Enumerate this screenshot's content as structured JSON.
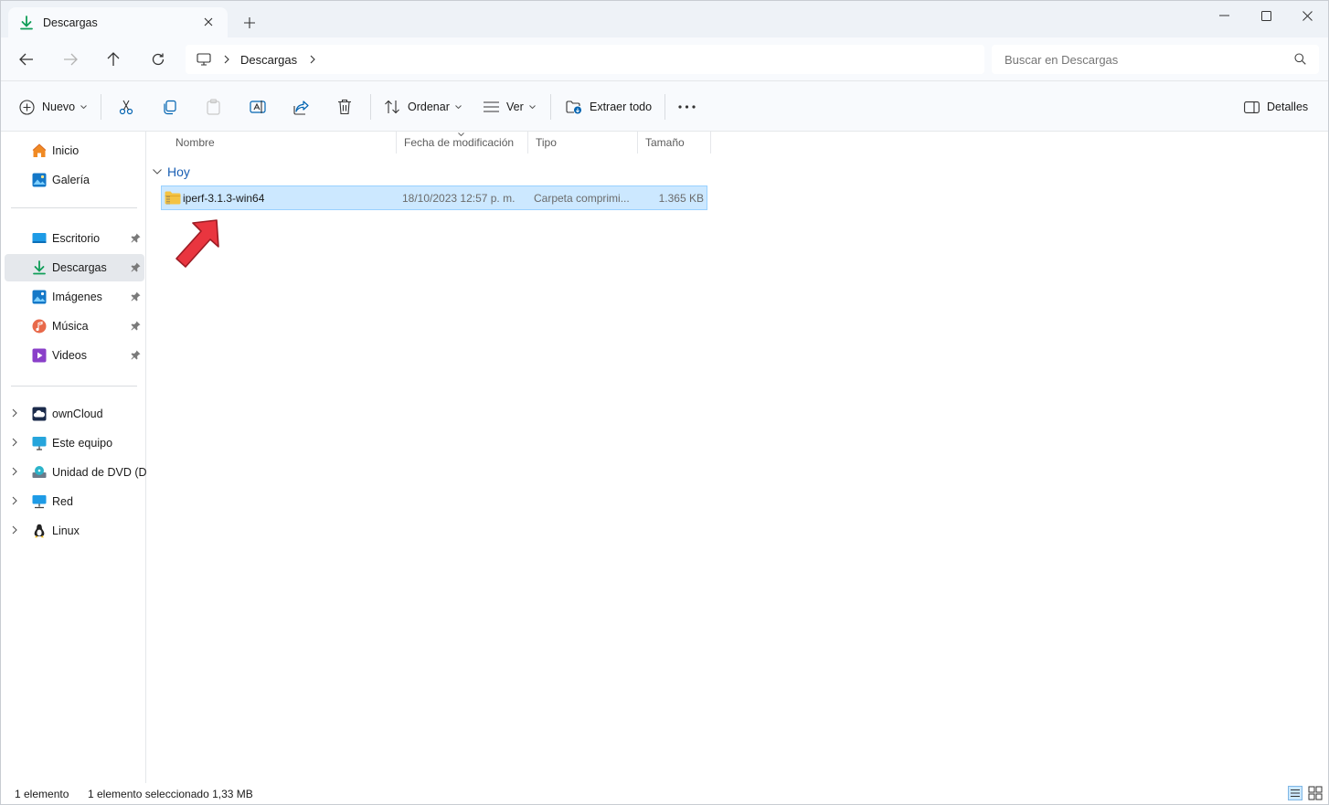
{
  "tab": {
    "title": "Descargas"
  },
  "address": {
    "crumb": "Descargas"
  },
  "search": {
    "placeholder": "Buscar en Descargas"
  },
  "commands": {
    "nuevo": "Nuevo",
    "ordenar": "Ordenar",
    "ver": "Ver",
    "extraer": "Extraer todo",
    "detalles": "Detalles"
  },
  "sidebar": {
    "items": [
      {
        "label": "Inicio",
        "icon": "home-icon"
      },
      {
        "label": "Galería",
        "icon": "gallery-icon"
      },
      {
        "label": "Escritorio",
        "icon": "desktop-icon",
        "pinned": true
      },
      {
        "label": "Descargas",
        "icon": "download-icon",
        "pinned": true,
        "selected": true
      },
      {
        "label": "Imágenes",
        "icon": "pictures-icon",
        "pinned": true
      },
      {
        "label": "Música",
        "icon": "music-icon",
        "pinned": true
      },
      {
        "label": "Videos",
        "icon": "videos-icon",
        "pinned": true
      },
      {
        "label": "ownCloud",
        "icon": "cloud-icon"
      },
      {
        "label": "Este equipo",
        "icon": "computer-icon"
      },
      {
        "label": "Unidad de DVD (D:)",
        "icon": "dvd-icon"
      },
      {
        "label": "Red",
        "icon": "network-icon"
      },
      {
        "label": "Linux",
        "icon": "linux-icon"
      }
    ]
  },
  "columns": [
    "Nombre",
    "Fecha de modificación",
    "Tipo",
    "Tamaño"
  ],
  "group": {
    "label": "Hoy"
  },
  "files": [
    {
      "name": "iperf-3.1.3-win64",
      "date": "18/10/2023 12:57 p. m.",
      "type": "Carpeta comprimi...",
      "size": "1.365 KB"
    }
  ],
  "status": {
    "count": "1 elemento",
    "selected": "1 elemento seleccionado  1,33 MB"
  },
  "colors": {
    "accent": "#0f9d58",
    "selection": "#cce8ff",
    "arrow": "#e9353f"
  }
}
